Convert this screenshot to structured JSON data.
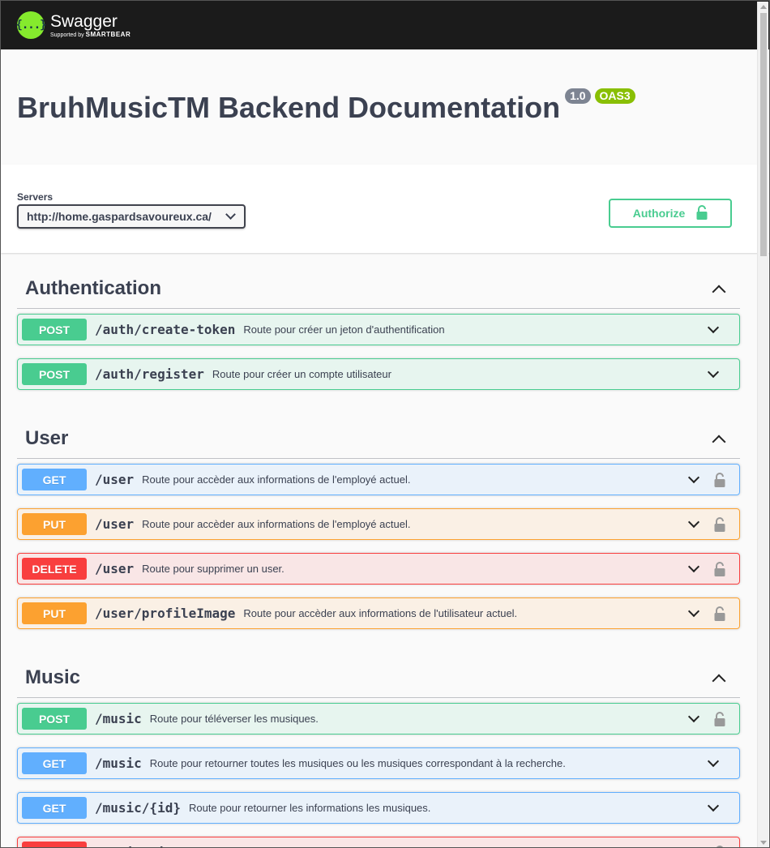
{
  "header": {
    "logo_mark": "{...}",
    "logo_title": "Swagger",
    "logo_sub_prefix": "Supported by",
    "logo_sub_brand": "SMARTBEAR"
  },
  "info": {
    "title": "BruhMusicTM Backend Documentation",
    "version": "1.0",
    "oas": "OAS3"
  },
  "servers": {
    "label": "Servers",
    "selected": "http://home.gaspardsavoureux.ca/"
  },
  "authorize": {
    "label": "Authorize"
  },
  "colors": {
    "post": "#49cc90",
    "get": "#61affe",
    "put": "#fca130",
    "delete": "#f93e3e",
    "topbar": "#1b1b1b"
  },
  "tags": [
    {
      "name": "Authentication",
      "ops": [
        {
          "method": "POST",
          "path": "/auth/create-token",
          "summary": "Route pour créer un jeton d'authentification",
          "locked": false
        },
        {
          "method": "POST",
          "path": "/auth/register",
          "summary": "Route pour créer un compte utilisateur",
          "locked": false
        }
      ]
    },
    {
      "name": "User",
      "ops": [
        {
          "method": "GET",
          "path": "/user",
          "summary": "Route pour accèder aux informations de l'employé actuel.",
          "locked": true
        },
        {
          "method": "PUT",
          "path": "/user",
          "summary": "Route pour accèder aux informations de l'employé actuel.",
          "locked": true
        },
        {
          "method": "DELETE",
          "path": "/user",
          "summary": "Route pour supprimer un user.",
          "locked": true
        },
        {
          "method": "PUT",
          "path": "/user/profileImage",
          "summary": "Route pour accèder aux informations de l'utilisateur actuel.",
          "locked": true
        }
      ]
    },
    {
      "name": "Music",
      "ops": [
        {
          "method": "POST",
          "path": "/music",
          "summary": "Route pour téléverser les musiques.",
          "locked": true
        },
        {
          "method": "GET",
          "path": "/music",
          "summary": "Route pour retourner toutes les musiques ou les musiques correspondant à la recherche.",
          "locked": false
        },
        {
          "method": "GET",
          "path": "/music/{id}",
          "summary": "Route pour retourner les informations les musiques.",
          "locked": false
        },
        {
          "method": "DELETE",
          "path": "/music/{id}",
          "summary": "Route pour supprimer une musique.",
          "locked": true
        }
      ]
    }
  ]
}
